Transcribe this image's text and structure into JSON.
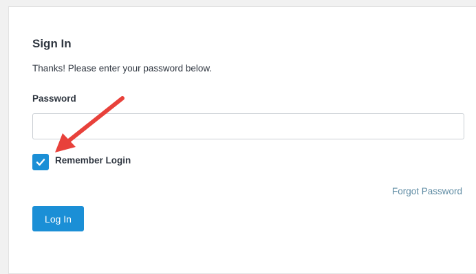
{
  "form": {
    "title": "Sign In",
    "subtitle": "Thanks! Please enter your password below.",
    "password_label": "Password",
    "password_value": "",
    "remember_label": "Remember Login",
    "remember_checked": true,
    "forgot_link": "Forgot Password",
    "login_button": "Log In"
  },
  "colors": {
    "accent": "#1b8fd6",
    "link": "#5e8ba3",
    "annotation_arrow": "#e8413b"
  },
  "icons": {
    "checkbox": "checkmark-icon",
    "annotation": "annotation-arrow"
  }
}
